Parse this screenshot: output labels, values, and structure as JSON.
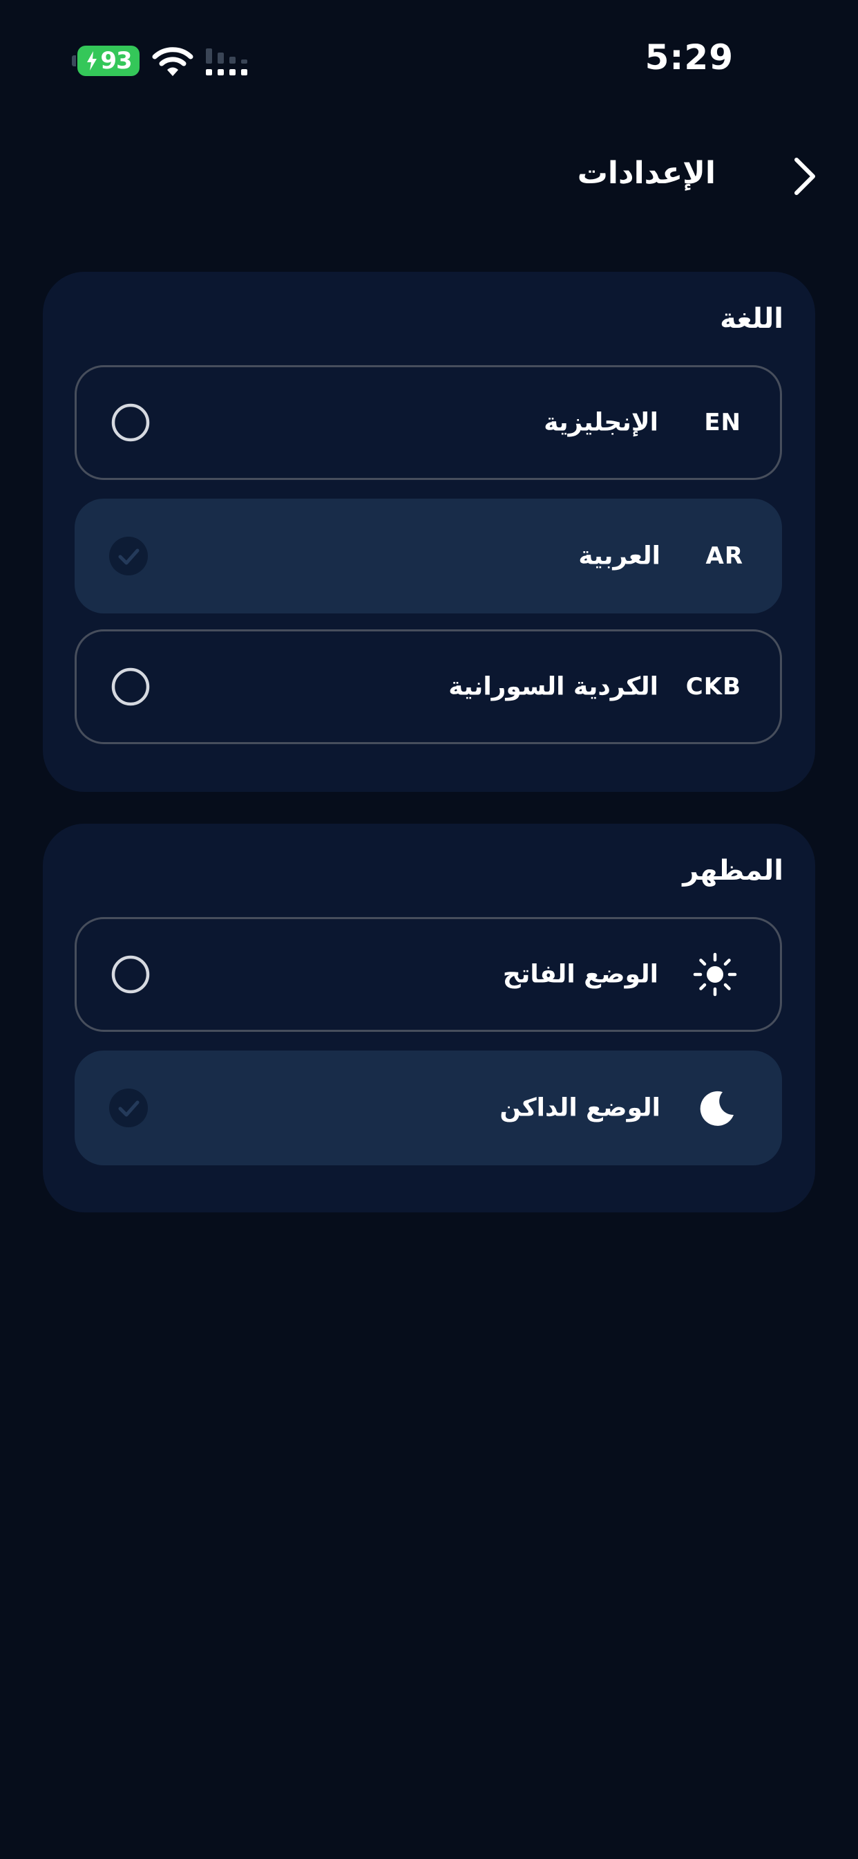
{
  "status_bar": {
    "battery_level": "93",
    "time": "5:29",
    "battery_color": "#34c759"
  },
  "header": {
    "title": "الإعدادات",
    "back_icon": "chevron-right-icon"
  },
  "language": {
    "title": "اللغة",
    "options": [
      {
        "code": "EN",
        "label": "الإنجليزية",
        "selected": false
      },
      {
        "code": "AR",
        "label": "العربية",
        "selected": true
      },
      {
        "code": "CKB",
        "label": "الكردية السورانية",
        "selected": false
      }
    ]
  },
  "appearance": {
    "title": "المظهر",
    "options": [
      {
        "icon": "sun-icon",
        "label": "الوضع الفاتح",
        "selected": false
      },
      {
        "icon": "moon-icon",
        "label": "الوضع الداكن",
        "selected": true
      }
    ]
  },
  "colors": {
    "background": "#060d1b",
    "card": "#0b1730",
    "selected_option": "#182c49",
    "option_border": "#474e5c"
  }
}
